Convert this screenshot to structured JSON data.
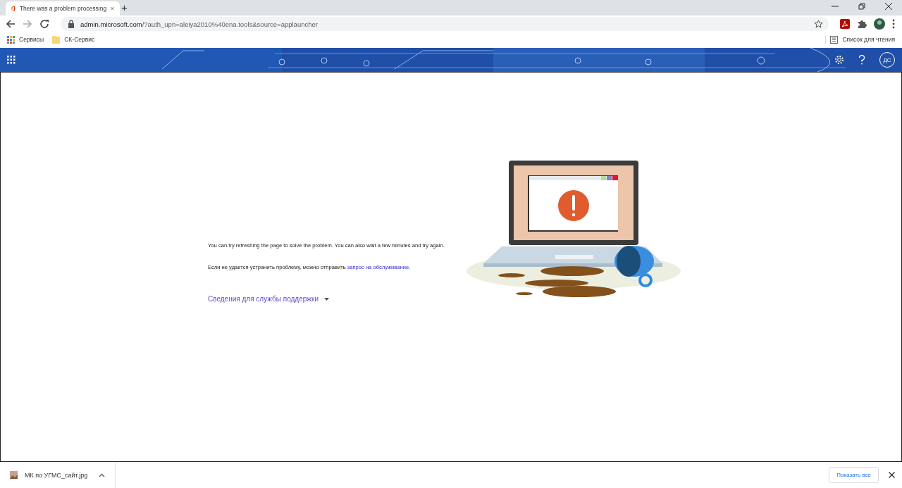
{
  "browser": {
    "tab": {
      "title": "There was a problem processing",
      "selected": true
    },
    "new_tab": "+",
    "url": {
      "host": "admin.microsoft.com",
      "path": "/?auth_upn=aleiya2010%40ena.tools&source=applauncher"
    },
    "bookmarks": [
      "Сервисы",
      "СК-Сервис"
    ],
    "reading_list": "Список для чтения"
  },
  "header": {
    "avatar": "ДС"
  },
  "error": {
    "message": "You can try refreshing the page to solve the problem. You can also wait a few minutes and try again.",
    "request_text": "Если не удается устранить проблему, можно отправить ",
    "request_link": "запрос на обслуживание",
    "request_end": ".",
    "support_toggle": "Сведения для службы поддержки",
    "expanded": false
  },
  "downloads": {
    "file": "МК по УГМС_сайт.jpg",
    "show_all": "Показать все"
  }
}
